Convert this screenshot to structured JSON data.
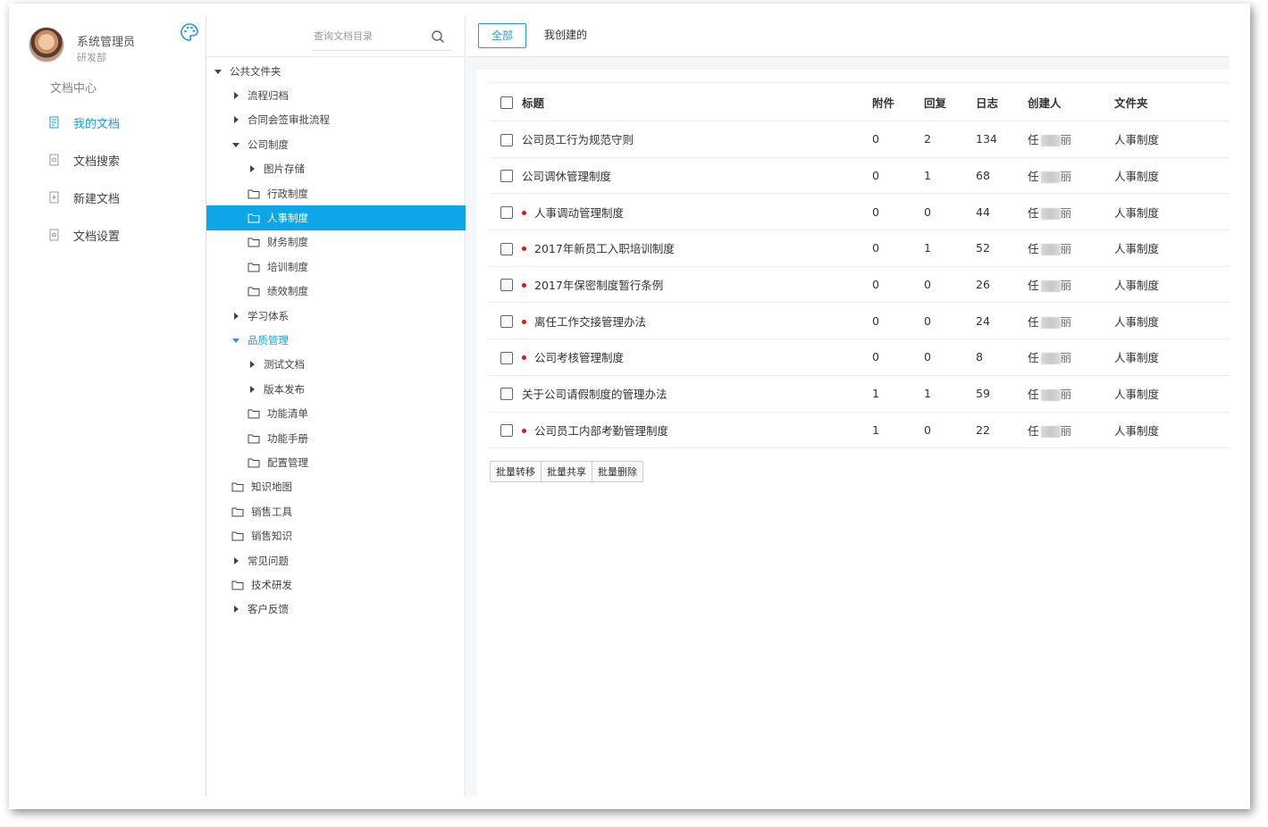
{
  "user": {
    "name": "系统管理员",
    "dept": "研发部"
  },
  "nav": {
    "section_title": "文档中心",
    "items": [
      {
        "label": "我的文档",
        "icon": "my-docs-icon",
        "active": true
      },
      {
        "label": "文档搜索",
        "icon": "doc-search-icon",
        "active": false
      },
      {
        "label": "新建文档",
        "icon": "new-doc-icon",
        "active": false
      },
      {
        "label": "文档设置",
        "icon": "doc-settings-icon",
        "active": false
      }
    ]
  },
  "tree": {
    "search_placeholder": "查询文档目录",
    "nodes": [
      {
        "label": "公共文件夹",
        "level": 0,
        "type": "open"
      },
      {
        "label": "流程归档",
        "level": 1,
        "type": "closed"
      },
      {
        "label": "合同会签审批流程",
        "level": 1,
        "type": "closed"
      },
      {
        "label": "公司制度",
        "level": 1,
        "type": "open"
      },
      {
        "label": "图片存储",
        "level": 2,
        "type": "closed"
      },
      {
        "label": "行政制度",
        "level": 2,
        "type": "folder"
      },
      {
        "label": "人事制度",
        "level": 2,
        "type": "folder",
        "selected": true
      },
      {
        "label": "财务制度",
        "level": 2,
        "type": "folder"
      },
      {
        "label": "培训制度",
        "level": 2,
        "type": "folder"
      },
      {
        "label": "绩效制度",
        "level": 2,
        "type": "folder"
      },
      {
        "label": "学习体系",
        "level": 1,
        "type": "closed"
      },
      {
        "label": "品质管理",
        "level": 1,
        "type": "open",
        "blue": true
      },
      {
        "label": "测试文档",
        "level": 2,
        "type": "closed"
      },
      {
        "label": "版本发布",
        "level": 2,
        "type": "closed"
      },
      {
        "label": "功能清单",
        "level": 2,
        "type": "folder"
      },
      {
        "label": "功能手册",
        "level": 2,
        "type": "folder"
      },
      {
        "label": "配置管理",
        "level": 2,
        "type": "folder"
      },
      {
        "label": "知识地图",
        "level": 1,
        "type": "folder"
      },
      {
        "label": "销售工具",
        "level": 1,
        "type": "folder"
      },
      {
        "label": "销售知识",
        "level": 1,
        "type": "folder"
      },
      {
        "label": "常见问题",
        "level": 1,
        "type": "closed"
      },
      {
        "label": "技术研发",
        "level": 1,
        "type": "folder"
      },
      {
        "label": "客户反馈",
        "level": 1,
        "type": "closed"
      }
    ]
  },
  "tabs": {
    "all": "全部",
    "mine": "我创建的"
  },
  "table": {
    "headers": {
      "title": "标题",
      "attachments": "附件",
      "replies": "回复",
      "logs": "日志",
      "creator": "创建人",
      "folder": "文件夹"
    },
    "rows": [
      {
        "title": "公司员工行为规范守则",
        "new": false,
        "attachments": "0",
        "replies": "2",
        "logs": "134",
        "creator_first": "任",
        "creator_last": "丽",
        "folder": "人事制度"
      },
      {
        "title": "公司调休管理制度",
        "new": false,
        "attachments": "0",
        "replies": "1",
        "logs": "68",
        "creator_first": "任",
        "creator_last": "丽",
        "folder": "人事制度"
      },
      {
        "title": "人事调动管理制度",
        "new": true,
        "attachments": "0",
        "replies": "0",
        "logs": "44",
        "creator_first": "任",
        "creator_last": "丽",
        "folder": "人事制度"
      },
      {
        "title": "2017年新员工入职培训制度",
        "new": true,
        "attachments": "0",
        "replies": "1",
        "logs": "52",
        "creator_first": "任",
        "creator_last": "丽",
        "folder": "人事制度"
      },
      {
        "title": "2017年保密制度暂行条例",
        "new": true,
        "attachments": "0",
        "replies": "0",
        "logs": "26",
        "creator_first": "任",
        "creator_last": "丽",
        "folder": "人事制度"
      },
      {
        "title": "离任工作交接管理办法",
        "new": true,
        "attachments": "0",
        "replies": "0",
        "logs": "24",
        "creator_first": "任",
        "creator_last": "丽",
        "folder": "人事制度"
      },
      {
        "title": "公司考核管理制度",
        "new": true,
        "attachments": "0",
        "replies": "0",
        "logs": "8",
        "creator_first": "任",
        "creator_last": "丽",
        "folder": "人事制度"
      },
      {
        "title": "关于公司请假制度的管理办法",
        "new": false,
        "attachments": "1",
        "replies": "1",
        "logs": "59",
        "creator_first": "任",
        "creator_last": "丽",
        "folder": "人事制度"
      },
      {
        "title": "公司员工内部考勤管理制度",
        "new": true,
        "attachments": "1",
        "replies": "0",
        "logs": "22",
        "creator_first": "任",
        "creator_last": "丽",
        "folder": "人事制度"
      }
    ]
  },
  "batch": {
    "move": "批量转移",
    "share": "批量共享",
    "delete": "批量删除"
  },
  "colors": {
    "accent": "#1e9be6",
    "selected_bg": "#0ea5e9",
    "new_dot": "#e0161b"
  }
}
